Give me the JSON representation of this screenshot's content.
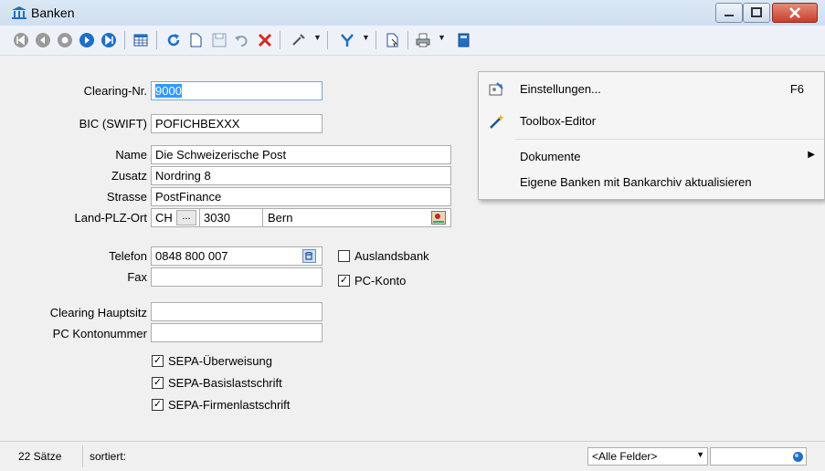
{
  "window": {
    "title": "Banken"
  },
  "toolbar": {
    "icons": [
      "first-record-icon",
      "previous-record-icon",
      "record-icon",
      "next-record-icon",
      "last-record-icon",
      "table-view-icon",
      "refresh-icon",
      "new-icon",
      "save-icon",
      "undo-icon",
      "delete-icon",
      "tools-icon",
      "filter-icon",
      "document-icon",
      "print-icon",
      "book-icon"
    ]
  },
  "form": {
    "clearing_label": "Clearing-Nr.",
    "clearing_value": "9000",
    "bic_label": "BIC (SWIFT)",
    "bic_value": "POFICHBEXXX",
    "name_label": "Name",
    "name_value": "Die Schweizerische Post",
    "zusatz_label": "Zusatz",
    "zusatz_value": "Nordring 8",
    "strasse_label": "Strasse",
    "strasse_value": "PostFinance",
    "land_label": "Land-PLZ-Ort",
    "land_value": "CH",
    "land_button": "...",
    "plz_value": "3030",
    "ort_value": "Bern",
    "telefon_label": "Telefon",
    "telefon_value": "0848 800 007",
    "fax_label": "Fax",
    "fax_value": "",
    "clearing_haupt_label": "Clearing Hauptsitz",
    "clearing_haupt_value": "",
    "pc_konto_label": "PC Kontonummer",
    "pc_konto_value": "",
    "auslandsbank_label": "Auslandsbank",
    "auslandsbank_checked": false,
    "pckonto_label": "PC-Konto",
    "pckonto_checked": true,
    "sepa_ueberweisung_label": "SEPA-Überweisung",
    "sepa_basis_label": "SEPA-Basislastschrift",
    "sepa_firmen_label": "SEPA-Firmenlastschrift"
  },
  "menu": {
    "items": [
      {
        "label": "Einstellungen...",
        "shortcut": "F6",
        "icon": "settings-icon"
      },
      {
        "label": "Toolbox-Editor",
        "shortcut": "",
        "icon": "wand-icon"
      },
      {
        "label": "Dokumente",
        "shortcut": "",
        "icon": ""
      },
      {
        "label": "Eigene Banken mit Bankarchiv aktualisieren",
        "shortcut": "",
        "icon": ""
      }
    ],
    "submenu_arrow": "▶"
  },
  "status": {
    "records": "22 Sätze",
    "sorted": "sortiert:",
    "field_combo": "<Alle Felder>"
  },
  "colors": {
    "nav_blue": "#1f6fc8",
    "nav_gray": "#8c8c8c",
    "delete_red": "#d42a1e",
    "titlebar": "#d6e4f3"
  }
}
